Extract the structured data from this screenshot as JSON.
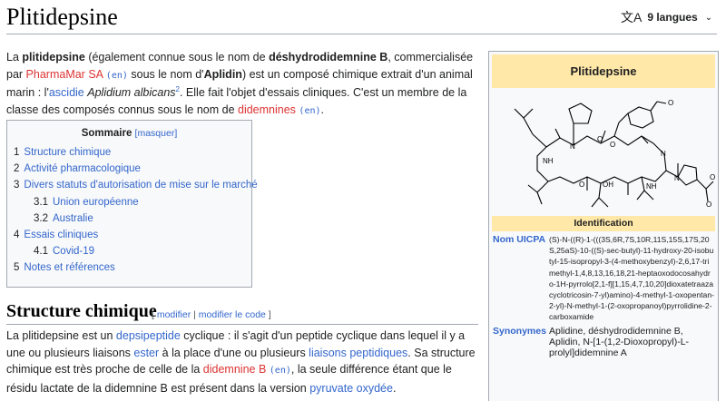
{
  "page": {
    "title": "Plitidepsine",
    "languages_label": "9 langues",
    "languages_icon": "translate-icon"
  },
  "intro": {
    "p1": "La ",
    "p2": "plitidepsine",
    "p3": " (également connue sous le nom de ",
    "p4": "déshydrodidemnine B",
    "p5": ", commercialisée par ",
    "p6": "PharmaMar SA",
    "p7": "(en)",
    "p8": " sous le nom d'",
    "p9": "Aplidin",
    "p10": ") est un composé chimique extrait d'un animal marin : l'",
    "p11": "ascidie",
    "p12": " ",
    "p13": "Aplidium albicans",
    "p14": "2",
    "p15": ". Elle fait l'objet d'essais cliniques. C'est un membre de la classe des composés connus sous le nom de ",
    "p16": "didemnines",
    "p17": "(en)",
    "p18": "."
  },
  "toc": {
    "title": "Sommaire",
    "toggle": "masquer",
    "items": [
      {
        "num": "1",
        "label": "Structure chimique",
        "level": 1
      },
      {
        "num": "2",
        "label": "Activité pharmacologique",
        "level": 1
      },
      {
        "num": "3",
        "label": "Divers statuts d'autorisation de mise sur le marché",
        "level": 1
      },
      {
        "num": "3.1",
        "label": "Union européenne",
        "level": 2
      },
      {
        "num": "3.2",
        "label": "Australie",
        "level": 2
      },
      {
        "num": "4",
        "label": "Essais cliniques",
        "level": 1
      },
      {
        "num": "4.1",
        "label": "Covid-19",
        "level": 2
      },
      {
        "num": "5",
        "label": "Notes et références",
        "level": 1
      }
    ]
  },
  "section": {
    "title": "Structure chimique",
    "edit_open": "[ ",
    "edit": "modifier",
    "sep": " | ",
    "edit_code": "modifier le code",
    "edit_close": " ]",
    "b1": "La plitidepsine est un ",
    "b2": "depsipeptide",
    "b3": " cyclique : il s'agit d'un peptide cyclique dans lequel il y a une ou plusieurs liaisons ",
    "b4": "ester",
    "b5": " à la place d'une ou plusieurs ",
    "b6": "liaisons peptidiques",
    "b7": ". Sa structure chimique est très proche de celle de la ",
    "b8": "didemnine B",
    "b9": "(en)",
    "b10": ", la seule différence étant que le résidu lactate de la didemnine B est présent dans la version ",
    "b11": "pyruvate oxydée",
    "b12": "."
  },
  "infobox": {
    "title": "Plitidepsine",
    "section": "Identification",
    "iupac_label": "Nom UICPA",
    "iupac_value": "(S)-N-((R)-1-(((3S,6R,7S,10R,11S,15S,17S,20S,25aS)-10-((S)-sec-butyl)-11-hydroxy-20-isobutyl-15-isopropyl-3-(4-methoxybenzyl)-2,6,17-trimethyl-1,4,8,13,16,18,21-heptaoxodocosahydro-1H-pyrrolo[2,1-f][1,15,4,7,10,20]dioxatetraazacyclotricosin-7-yl)amino)-4-methyl-1-oxopentan-2-yl)-N-methyl-1-(2-oxopropanoyl)pyrrolidine-2-carboxamide",
    "syn_label": "Synonymes",
    "syn_value": "Aplidine, déshydrodidemnine B, Aplidin, N-[1-(1,2-Dioxopropyl)-L-prolyl]didemnine A"
  },
  "colors": {
    "link": "#3366cc",
    "redlink": "#dd3333",
    "infobox_header": "#ffe8a8"
  }
}
